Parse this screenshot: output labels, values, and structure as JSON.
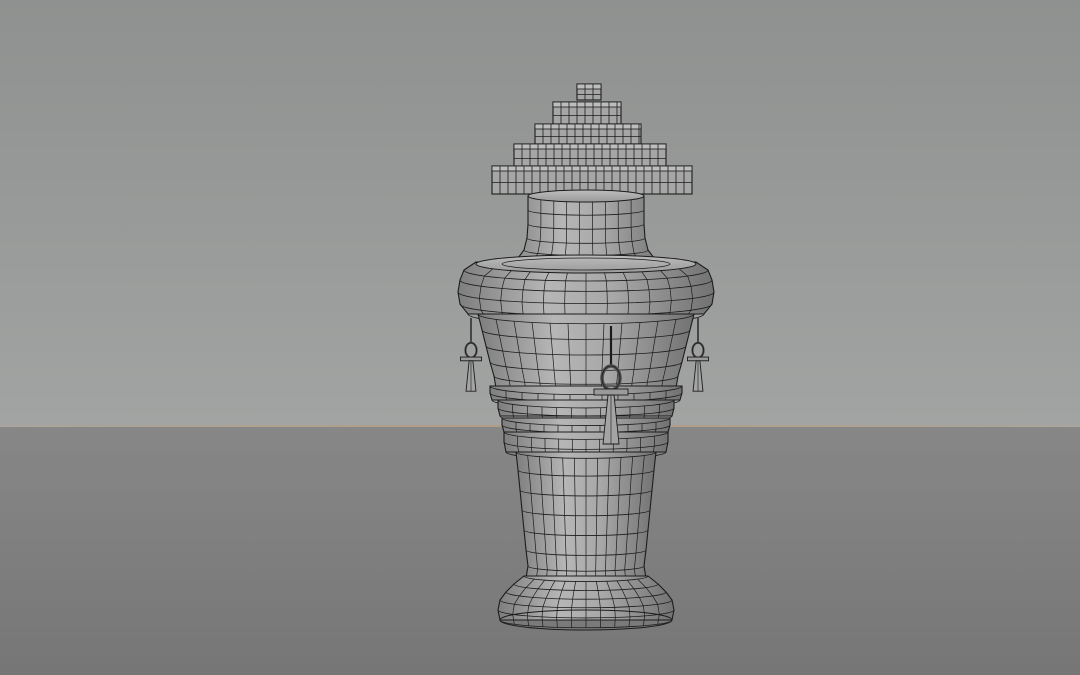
{
  "scene": {
    "subject": "canopic-urn-wireframe",
    "colors": {
      "wall": "#999b9a",
      "floor": "#7f7f7f",
      "horizon": "#b29c82",
      "mesh_fill": "#9c9c9c",
      "mesh_fill_light": "#b4b4b4",
      "mesh_fill_dark": "#7a7a7a",
      "wire": "#1c1c1c"
    }
  }
}
